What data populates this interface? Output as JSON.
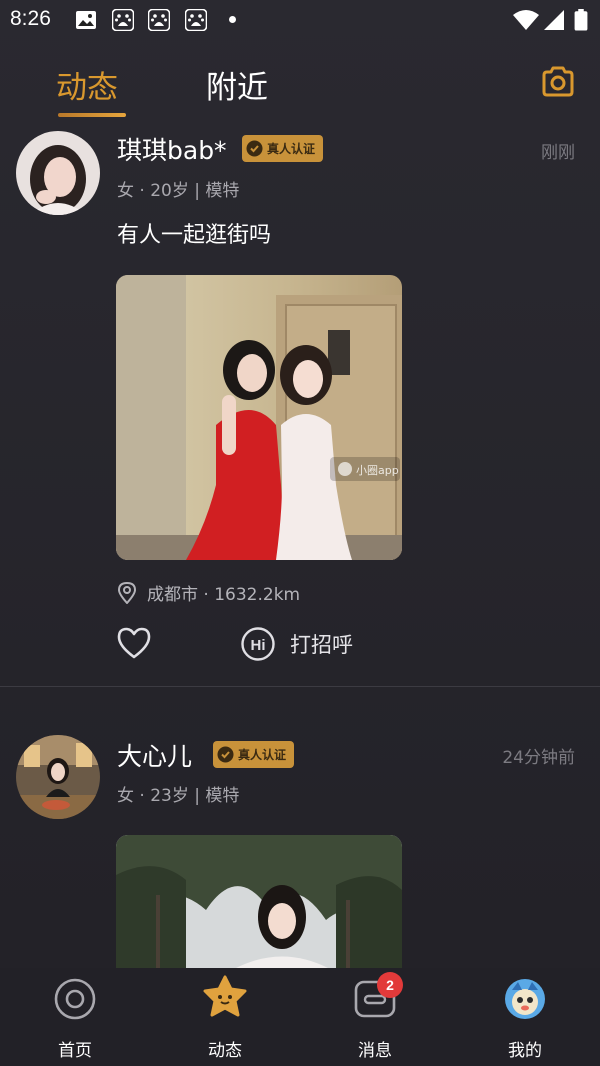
{
  "status_bar": {
    "time": "8:26"
  },
  "header": {
    "tabs": [
      {
        "label": "动态"
      },
      {
        "label": "附近"
      }
    ],
    "active_tab": "动态"
  },
  "posts": [
    {
      "username": "琪琪bab*",
      "badge": "真人认证",
      "time": "刚刚",
      "meta": "女 · 20岁 | 模特",
      "text": "有人一起逛街吗",
      "watermark": "小圈app",
      "location": "成都市 · 1632.2km",
      "greet": "打招呼"
    },
    {
      "username": "大心儿",
      "badge": "真人认证",
      "time": "24分钟前",
      "meta": "女 · 23岁 | 模特"
    }
  ],
  "bottom_nav": {
    "items": [
      {
        "label": "首页"
      },
      {
        "label": "动态"
      },
      {
        "label": "消息",
        "badge": "2"
      },
      {
        "label": "我的"
      }
    ]
  },
  "colors": {
    "accent": "#d9982e",
    "background": "#26252b",
    "badge_red": "#e23a3a"
  }
}
